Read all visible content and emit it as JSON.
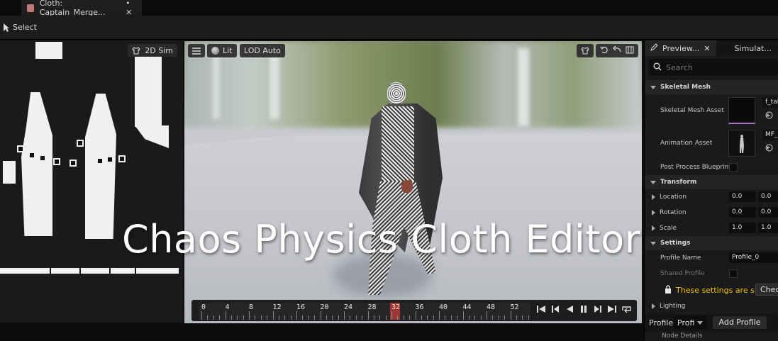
{
  "tab": {
    "title": "Cloth: Captain_Merge...",
    "controls": "• ✕"
  },
  "toolbar": {
    "select_label": "Select"
  },
  "panel2d": {
    "sim_button_label": "2D Sim"
  },
  "viewport": {
    "lit_label": "Lit",
    "lod_label": "LOD Auto",
    "timeline": {
      "ticks": [
        "0",
        "4",
        "8",
        "12",
        "16",
        "20",
        "24",
        "28",
        "32",
        "36",
        "40",
        "44",
        "48",
        "52"
      ],
      "current_frame": "32"
    }
  },
  "details": {
    "tabs": [
      {
        "label": "Preview...",
        "close": "✕"
      },
      {
        "label": "Simulat..."
      }
    ],
    "search_placeholder": "Search",
    "skeletal_mesh": {
      "header": "Skeletal Mesh",
      "skeletal_mesh_asset_label": "Skeletal Mesh Asset",
      "skeletal_mesh_asset_value": "f_tal",
      "animation_asset_label": "Animation Asset",
      "animation_asset_value": "MF_",
      "post_process_label": "Post Process Blueprint"
    },
    "transform": {
      "header": "Transform",
      "location_label": "Location",
      "location_values": [
        "0.0",
        "0.0"
      ],
      "rotation_label": "Rotation",
      "rotation_values": [
        "0.0",
        "0.0"
      ],
      "scale_label": "Scale",
      "scale_values": [
        "1.0",
        "1.0"
      ]
    },
    "settings": {
      "header": "Settings",
      "profile_name_label": "Profile Name",
      "profile_name_value": "Profile_0",
      "shared_profile_label": "Shared Profile",
      "warning_text": "These settings are s",
      "check_button": "Check"
    },
    "lighting_label": "Lighting",
    "profile_row": {
      "label": "Profile",
      "dropdown_value": "Profi",
      "add_button": "Add Profile"
    },
    "node_details_label": "Node Details"
  },
  "overlay_title": "Chaos Physics Cloth Editor",
  "colors": {
    "accent_red": "#c83c3c",
    "warning_yellow": "#f0c000",
    "panel_bg": "#1a1a1a"
  }
}
